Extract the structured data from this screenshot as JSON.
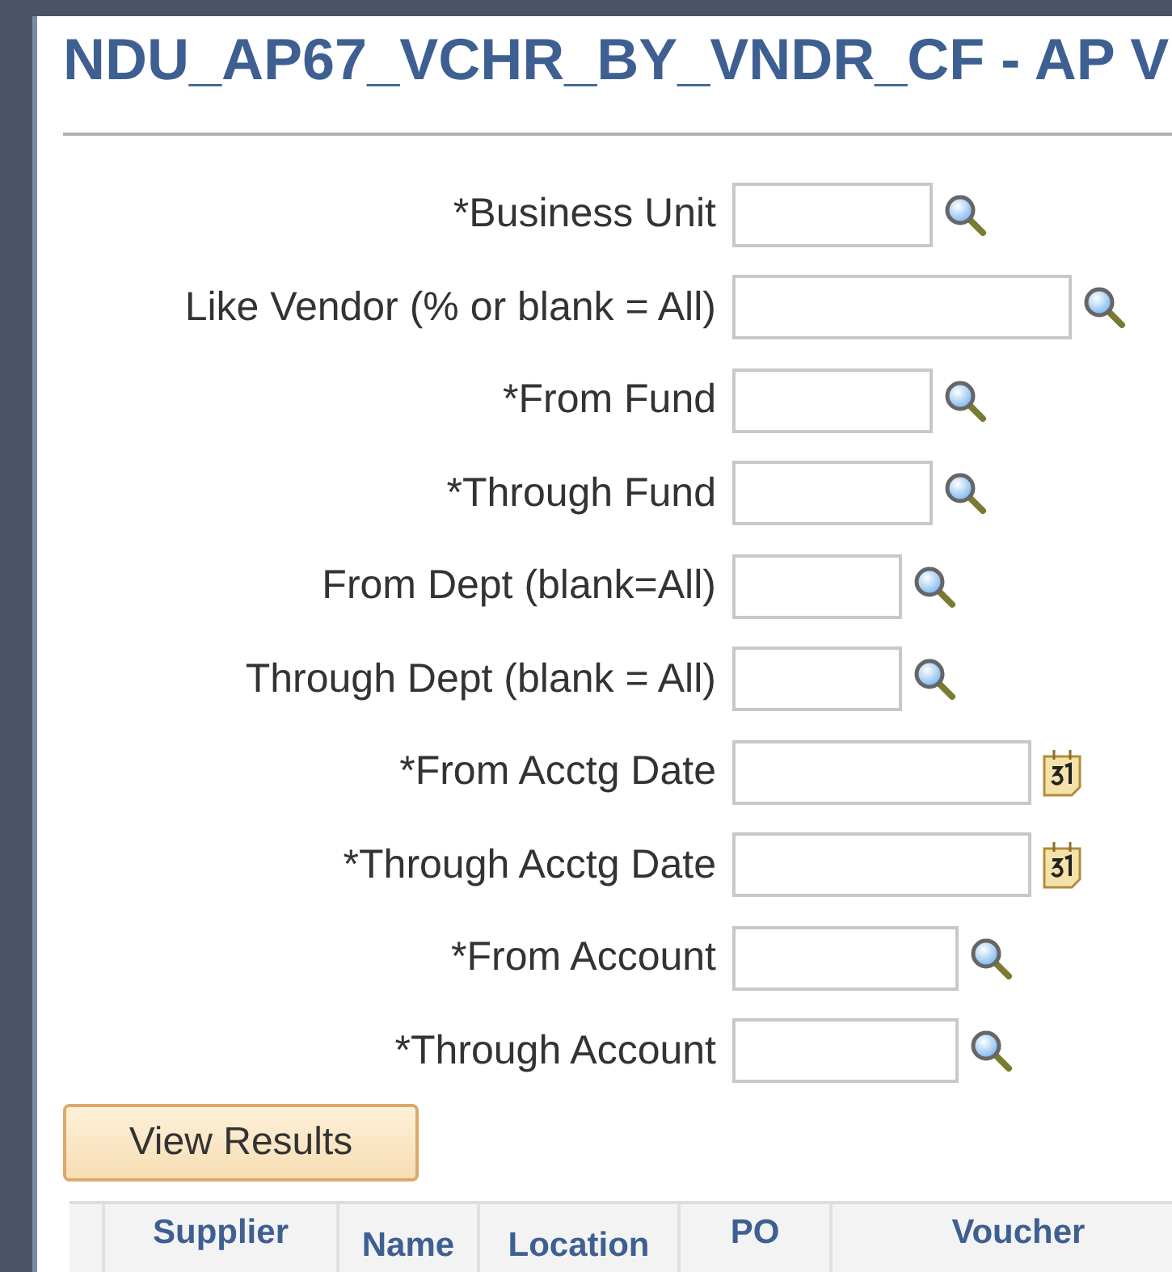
{
  "page": {
    "title": "NDU_AP67_VCHR_BY_VNDR_CF - AP V"
  },
  "fields": [
    {
      "label": "*Business Unit",
      "kind": "lookup"
    },
    {
      "label": "Like Vendor (% or blank = All)",
      "kind": "lookup"
    },
    {
      "label": "*From Fund",
      "kind": "lookup"
    },
    {
      "label": "*Through Fund",
      "kind": "lookup"
    },
    {
      "label": "From Dept (blank=All)",
      "kind": "lookup"
    },
    {
      "label": "Through Dept (blank = All)",
      "kind": "lookup"
    },
    {
      "label": "*From Acctg Date",
      "kind": "calendar"
    },
    {
      "label": "*Through Acctg Date",
      "kind": "calendar"
    },
    {
      "label": "*From Account",
      "kind": "lookup"
    },
    {
      "label": "*Through Account",
      "kind": "lookup"
    }
  ],
  "button": "View Results",
  "table": {
    "columns": [
      "Supplier",
      "Name",
      "Location",
      "PO",
      "Voucher"
    ]
  }
}
